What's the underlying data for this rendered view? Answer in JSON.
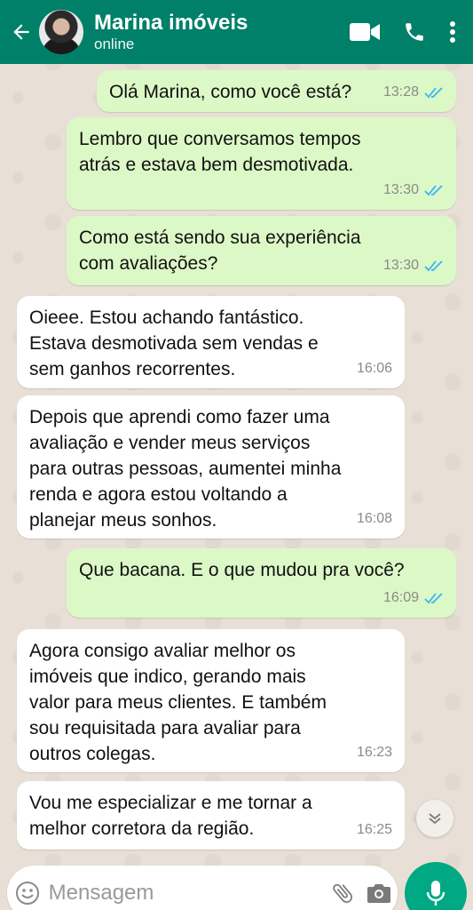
{
  "header": {
    "contact_name": "Marina imóveis",
    "status": "online"
  },
  "messages": [
    {
      "direction": "out",
      "text": "Olá Marina, como você está?",
      "time": "13:28",
      "read": true
    },
    {
      "direction": "out",
      "text": "Lembro que conversamos tempos\natrás e estava bem desmotivada.",
      "time": "13:30",
      "read": true
    },
    {
      "direction": "out",
      "text": "Como está sendo sua experiência\ncom avaliações?",
      "time": "13:30",
      "read": true
    },
    {
      "direction": "in",
      "text": "Oieee. Estou achando fantástico.\nEstava desmotivada sem vendas e\nsem ganhos recorrentes.",
      "time": "16:06"
    },
    {
      "direction": "in",
      "text": "Depois que aprendi como fazer uma\navaliação e vender meus serviços\npara outras pessoas, aumentei minha\nrenda e agora estou voltando a\nplanejar meus sonhos.",
      "time": "16:08"
    },
    {
      "direction": "out",
      "text": "Que bacana. E o que mudou pra você?",
      "time": "16:09",
      "read": true
    },
    {
      "direction": "in",
      "text": "Agora consigo avaliar melhor os\nimóveis que indico, gerando mais\nvalor para meus clientes. E também\nsou requisitada para avaliar para\noutros colegas.",
      "time": "16:23"
    },
    {
      "direction": "in",
      "text": "Vou me especializar e me tornar a\nmelhor corretora da região.",
      "time": "16:25"
    }
  ],
  "composer": {
    "placeholder": "Mensagem"
  },
  "colors": {
    "header": "#008069",
    "outgoing_bubble": "#dcf8c6",
    "incoming_bubble": "#ffffff",
    "read_ticks": "#34b7f1",
    "mic_button": "#00a884"
  },
  "icons": [
    "back-arrow-icon",
    "video-call-icon",
    "phone-icon",
    "more-options-icon",
    "emoji-icon",
    "attach-icon",
    "camera-icon",
    "mic-icon",
    "double-check-icon",
    "chevron-down-icon"
  ]
}
